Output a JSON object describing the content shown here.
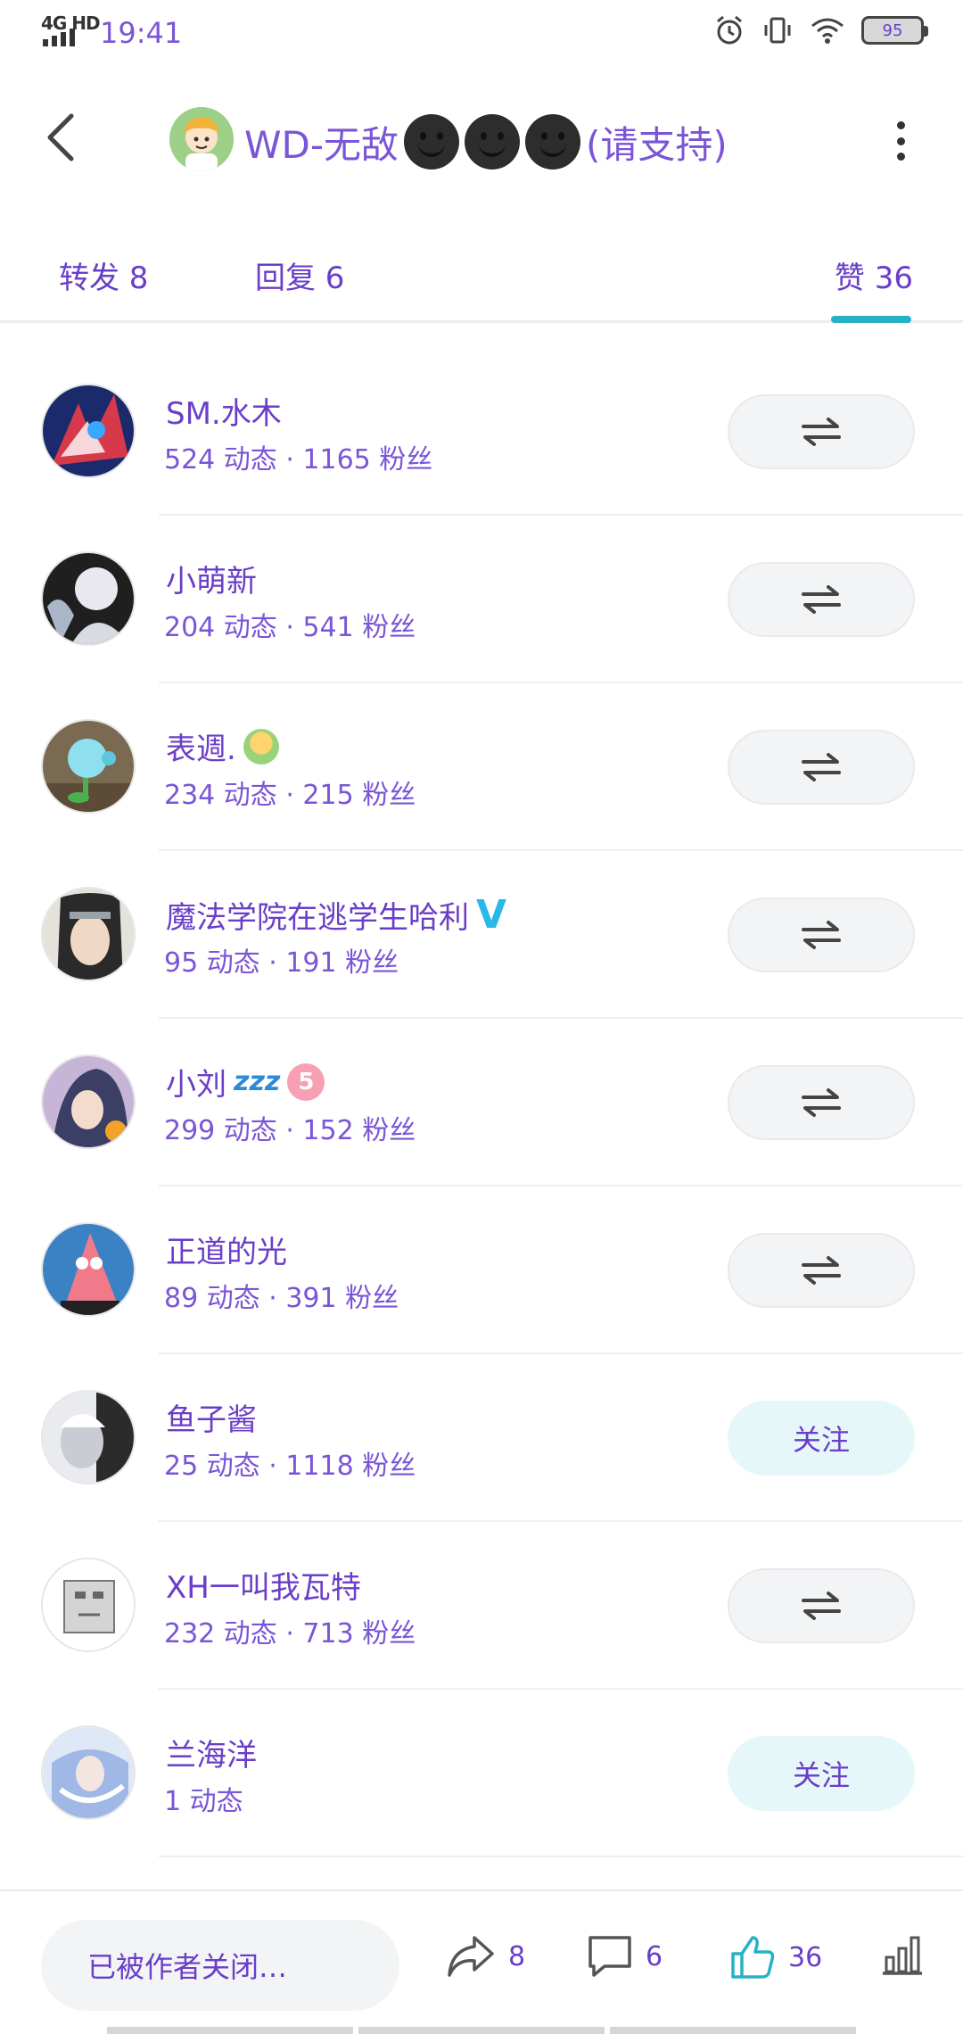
{
  "status_bar": {
    "network": "4G HD",
    "time": "19:41",
    "battery": "95"
  },
  "header": {
    "title": "WD-无敌",
    "title_suffix": "(请支持)"
  },
  "tabs": [
    {
      "label": "转发 8"
    },
    {
      "label": "回复 6"
    },
    {
      "label": "赞 36",
      "active": true
    }
  ],
  "users": [
    {
      "name": "SM.水木",
      "stats": "524 动态 · 1165 粉丝",
      "action": "mutual",
      "avatar_color": "#1b2a6b"
    },
    {
      "name": "小萌新",
      "stats": "204 动态 · 541 粉丝",
      "action": "mutual",
      "avatar_color": "#cfd3da"
    },
    {
      "name": "表週.",
      "stats": "234 动态 · 215 粉丝",
      "action": "mutual",
      "avatar_color": "#7a6a52"
    },
    {
      "name": "魔法学院在逃学生哈利",
      "stats": "95 动态 · 191 粉丝",
      "action": "mutual",
      "avatar_color": "#3a3a3a"
    },
    {
      "name": "小刘",
      "stats": "299 动态 · 152 粉丝",
      "action": "mutual",
      "avatar_color": "#3b3f66"
    },
    {
      "name": "正道的光",
      "stats": "89 动态 · 391 粉丝",
      "action": "mutual",
      "avatar_color": "#f07a8a"
    },
    {
      "name": "鱼子酱",
      "stats": "25 动态 · 1118 粉丝",
      "action": "follow",
      "avatar_color": "#bfc3c8"
    },
    {
      "name": "XH一叫我瓦特",
      "stats": "232 动态 · 713 粉丝",
      "action": "mutual",
      "avatar_color": "#f2f2f2"
    },
    {
      "name": "兰海洋",
      "stats": "1 动态",
      "action": "follow",
      "avatar_color": "#9fb8e6"
    }
  ],
  "follow_label": "关注",
  "bottom_bar": {
    "comment_placeholder": "已被作者关闭…",
    "share_count": "8",
    "comment_count": "6",
    "like_count": "36"
  },
  "colors": {
    "accent": "#26b2c4",
    "text": "#6a3ec8"
  }
}
